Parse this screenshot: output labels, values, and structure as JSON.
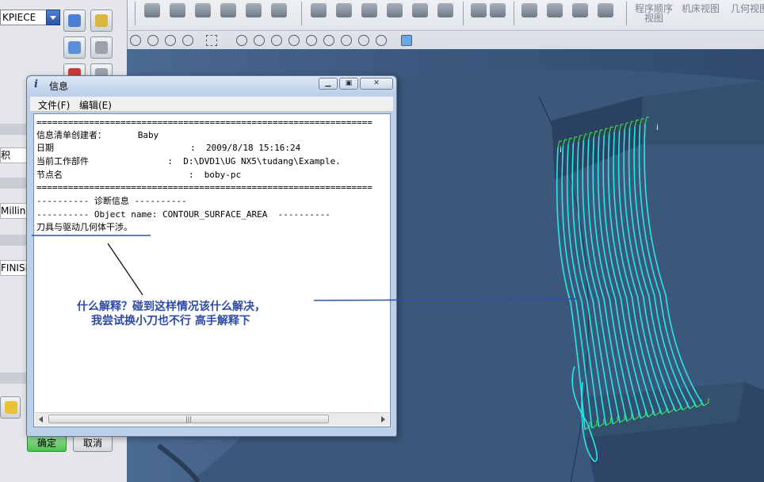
{
  "left_panel": {
    "combo_value": "KPIECE",
    "row_labels": [
      "积",
      "Milling",
      "FINISH"
    ],
    "ok_label": "确定",
    "cancel_label": "取消"
  },
  "nav_labels": {
    "program_order": "程序顺序",
    "program_order_sub": "视图",
    "machine_view": "机床视图",
    "geometry_view": "几何视图"
  },
  "dialog": {
    "title": "信息",
    "menu": [
      "文件(F)",
      "编辑(E)"
    ],
    "lines": [
      "================================================================",
      "信息清单创建者：      Baby",
      "日期                          :  2009/8/18 15:16:24",
      "当前工作部件               :  D:\\DVD1\\UG NX5\\tudang\\Example.",
      "节点名                        :  boby-pc",
      "================================================================",
      "---------- 诊断信息 ----------",
      "---------- Object name: CONTOUR_SURFACE_AREA  ----------",
      "刀具与驱动几何体干涉。"
    ],
    "scroll_thumb_label": "|||"
  },
  "annotation": {
    "line1": "什么解释？碰到这样情况该什么解决，",
    "line2": "我尝试换小刀也不行   高手解释下"
  },
  "colors": {
    "toolpath": "#26e8e8",
    "toolpath_green": "#3fd84a",
    "annotation": "#2d49a6",
    "annotation_line": "#2f4fa8",
    "viewport_bg": "#3d5a80",
    "part_face": "#34506f"
  }
}
